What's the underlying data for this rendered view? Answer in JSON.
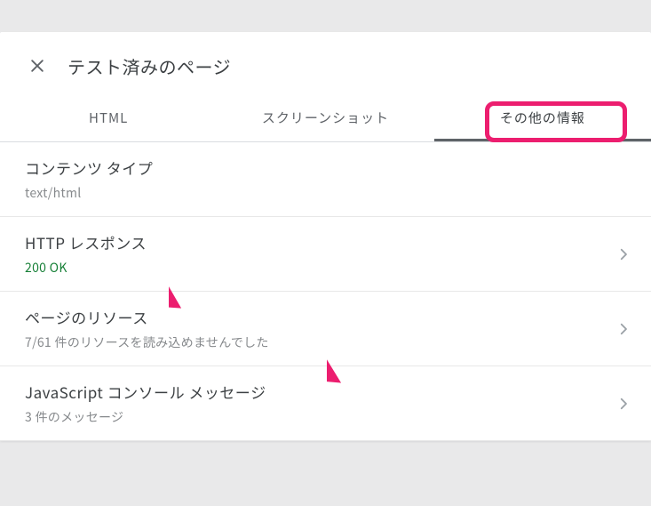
{
  "header": {
    "title": "テスト済みのページ"
  },
  "tabs": [
    {
      "label": "HTML",
      "active": false
    },
    {
      "label": "スクリーンショット",
      "active": false
    },
    {
      "label": "その他の情報",
      "active": true
    }
  ],
  "rows": {
    "content_type": {
      "label": "コンテンツ タイプ",
      "sub": "text/html"
    },
    "http_response": {
      "label": "HTTP レスポンス",
      "sub": "200 OK"
    },
    "page_resources": {
      "label": "ページのリソース",
      "sub": "7/61 件のリソースを読み込めませんでした"
    },
    "js_console": {
      "label": "JavaScript コンソール メッセージ",
      "sub": "3 件のメッセージ"
    }
  },
  "highlight_color": "#ec1e6f"
}
